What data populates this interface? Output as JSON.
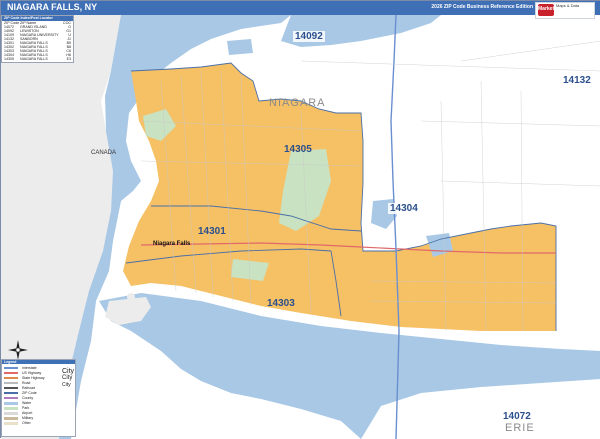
{
  "header": {
    "title": "NIAGARA FALLS, NY",
    "subtitle": "2026 ZIP Code Business Reference Edition",
    "logo_text": [
      "MarketMAPS",
      "Maps & Data"
    ],
    "color": "#3f6fb5"
  },
  "legend": {
    "title": "ZIP Code Index/Post Locator",
    "columns": [
      "ZIP Code",
      "ZIP Name",
      "COC"
    ],
    "rows": [
      {
        "zip": "14072",
        "name": "GRAND ISLAND",
        "code": "G"
      },
      {
        "zip": "14092",
        "name": "LEWISTON",
        "code": "G1"
      },
      {
        "zip": "14109",
        "name": "NIAGARA UNIVERSITY",
        "code": "U"
      },
      {
        "zip": "14132",
        "name": "SANBORN",
        "code": "J1"
      },
      {
        "zip": "14301",
        "name": "NIAGARA FALLS",
        "code": "B5"
      },
      {
        "zip": "14302",
        "name": "NIAGARA FALLS",
        "code": "B8"
      },
      {
        "zip": "14303",
        "name": "NIAGARA FALLS",
        "code": "C6"
      },
      {
        "zip": "14304",
        "name": "NIAGARA FALLS",
        "code": "H6"
      },
      {
        "zip": "14305",
        "name": "NIAGARA FALLS",
        "code": "E3"
      }
    ]
  },
  "map": {
    "zip_labels": [
      "14092",
      "14132",
      "14305",
      "14301",
      "14304",
      "14303",
      "14072"
    ],
    "place_labels": [
      "NIAGARA",
      "ERIE"
    ],
    "country_label": "CANADA",
    "city_label": "Niagara Falls",
    "colors": {
      "water": "#a8c8e6",
      "zip_fill": "#f6c065",
      "land": "#ffffff",
      "canada_land": "#ececec",
      "park": "#c9e2c1",
      "highway": "#e06a6a",
      "road": "#c8c8c8",
      "zip_border": "#4a6fa8"
    }
  },
  "key": {
    "title": "Legend",
    "big_city": [
      "City",
      "City",
      "City"
    ],
    "items": [
      "Interstate",
      "US Highway",
      "State Highway",
      "Road",
      "Railroad",
      "ZIP Code",
      "County",
      "Water",
      "Park",
      "Airport",
      "Military",
      "Other"
    ]
  },
  "icons": {
    "compass": "north-arrow-icon"
  }
}
